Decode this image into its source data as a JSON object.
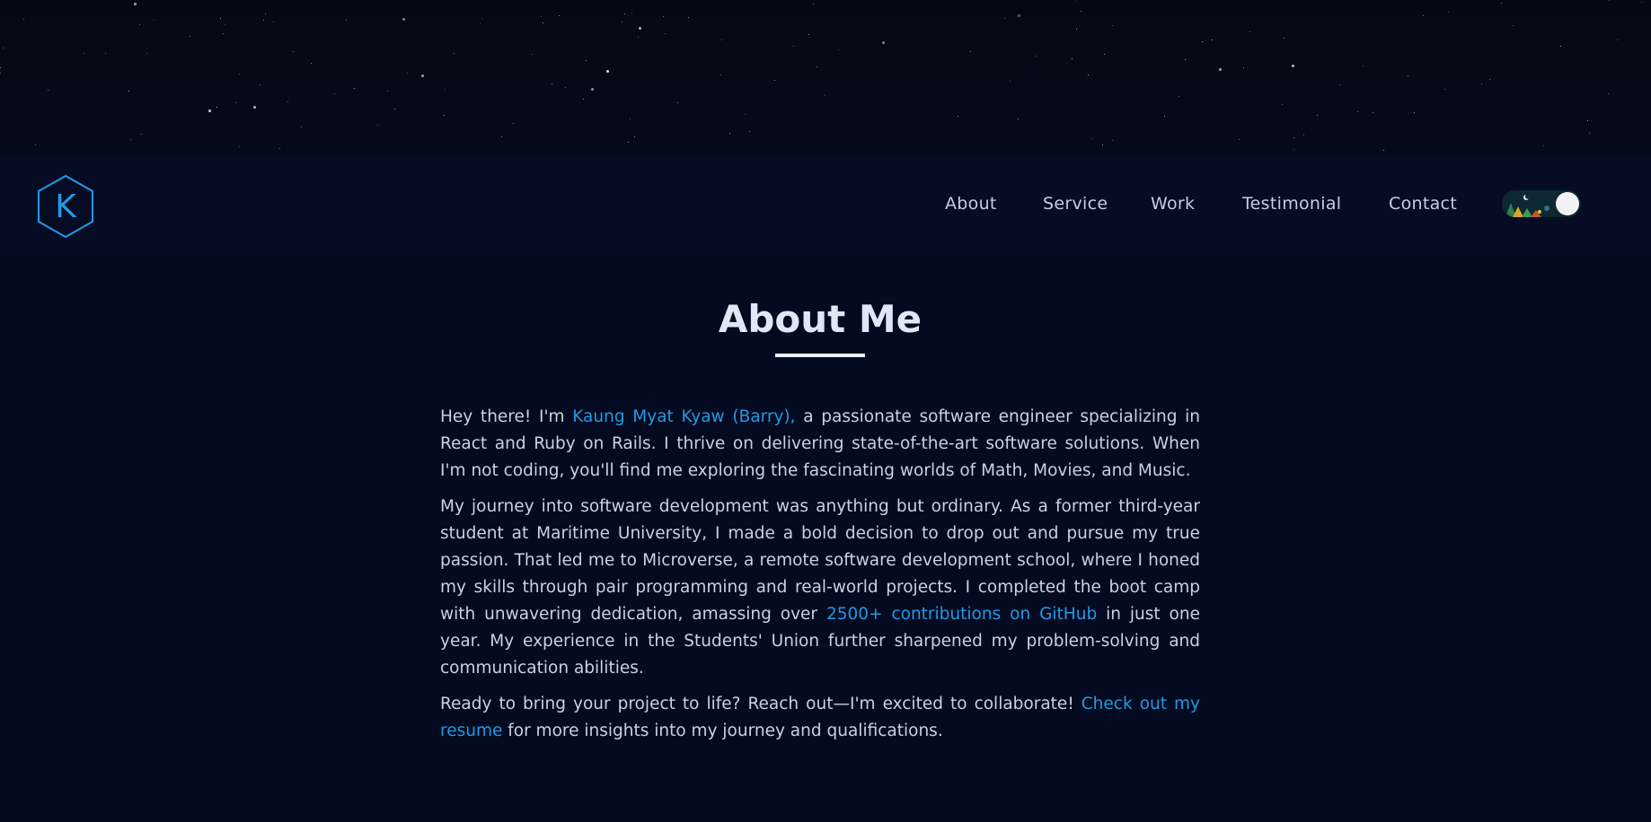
{
  "brand": {
    "logo_letter": "K",
    "accent_color": "#1f9be6"
  },
  "nav": {
    "items": [
      {
        "label": "About"
      },
      {
        "label": "Service"
      },
      {
        "label": "Work"
      },
      {
        "label": "Testimonial"
      },
      {
        "label": "Contact"
      }
    ],
    "theme_toggle": {
      "state": "night",
      "icon": "night-scene-toggle-icon"
    }
  },
  "about": {
    "title": "About Me",
    "p1": {
      "before": "Hey there! I'm ",
      "name_link": "Kaung Myat Kyaw (Barry),",
      "after": " a passionate software engineer specializing in React and Ruby on Rails. I thrive on delivering state-of-the-art software solutions. When I'm not coding, you'll find me exploring the fascinating worlds of Math, Movies, and Music."
    },
    "p2": {
      "before": "My journey into software development was anything but ordinary. As a former third-year student at Maritime University, I made a bold decision to drop out and pursue my true passion. That led me to Microverse, a remote software development school, where I honed my skills through pair programming and real-world projects. I completed the boot camp with unwavering dedication, amassing over ",
      "github_link": "2500+ contributions on GitHub",
      "after": " in just one year. My experience in the Students' Union further sharpened my problem-solving and communication abilities."
    },
    "p3": {
      "before": "Ready to bring your project to life? Reach out—I'm excited to collaborate! ",
      "resume_link": "Check out my resume",
      "after": " for more insights into my journey and qualifications."
    }
  }
}
